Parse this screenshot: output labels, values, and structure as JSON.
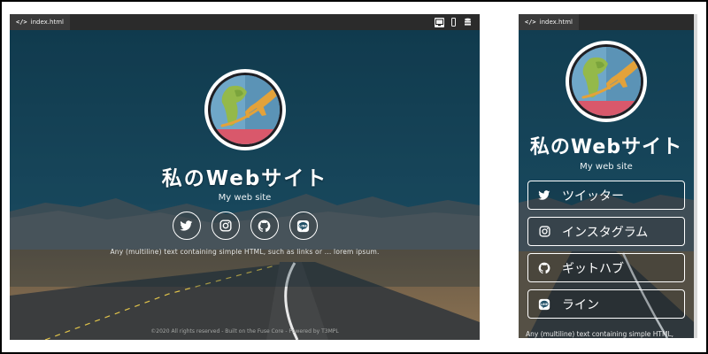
{
  "desktop": {
    "tab_label": "index.html",
    "device_icons": [
      "desktop-view-icon",
      "mobile-view-icon",
      "stack-icon"
    ],
    "site_title": "私のWebサイト",
    "site_subtitle": "My web site",
    "social_icons": [
      "twitter-icon",
      "instagram-icon",
      "github-icon",
      "line-icon"
    ],
    "text": "Any (multiline) text containing simple HTML, such as links or ... lorem ipsum.",
    "footer": "©2020 All rights reserved - Built on the Fuse Core - Powered by T3MPL"
  },
  "mobile": {
    "tab_label": "index.html",
    "site_title": "私のWebサイト",
    "site_subtitle": "My web site",
    "buttons": [
      {
        "icon": "twitter-icon",
        "label": "ツイッター"
      },
      {
        "icon": "instagram-icon",
        "label": "インスタグラム"
      },
      {
        "icon": "github-icon",
        "label": "ギットハブ"
      },
      {
        "icon": "line-icon",
        "label": "ライン"
      }
    ],
    "text": "Any (multiline) text containing simple HTML,"
  },
  "colors": {
    "sky": "#17475c",
    "mountain": "#5c6266",
    "road": "#3a3c3c",
    "globe_ocean": "#6fa7c8",
    "plane": "#e3a23a",
    "globe_base": "#d9586b"
  }
}
